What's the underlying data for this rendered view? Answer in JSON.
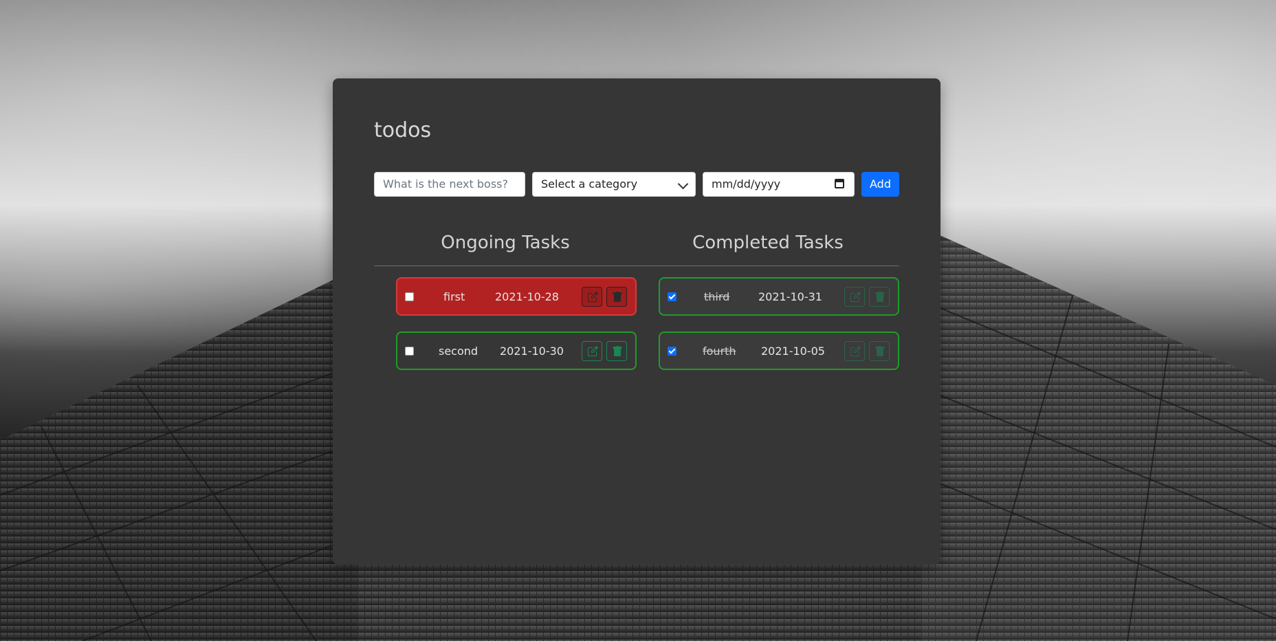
{
  "app": {
    "title": "todos"
  },
  "form": {
    "task_placeholder": "What is the next boss?",
    "category_selected": "Select a category",
    "date_value": "mm/dd/yyyy",
    "add_label": "Add"
  },
  "columns": {
    "ongoing_title": "Ongoing Tasks",
    "completed_title": "Completed Tasks"
  },
  "ongoing": [
    {
      "name": "first",
      "date": "2021-10-28",
      "checked": false,
      "status": "overdue"
    },
    {
      "name": "second",
      "date": "2021-10-30",
      "checked": false,
      "status": "normal"
    }
  ],
  "completed": [
    {
      "name": "third",
      "date": "2021-10-31",
      "checked": true,
      "status": "done"
    },
    {
      "name": "fourth",
      "date": "2021-10-05",
      "checked": true,
      "status": "done"
    }
  ],
  "colors": {
    "accent": "#0d6efd",
    "overdue": "#b22222",
    "ok_border": "#1f9c2b",
    "action": "#198754",
    "card": "#363636"
  },
  "icons": {
    "edit": "pencil-square-icon",
    "delete": "trash-icon",
    "calendar": "calendar-icon",
    "dropdown": "chevron-down-icon"
  }
}
